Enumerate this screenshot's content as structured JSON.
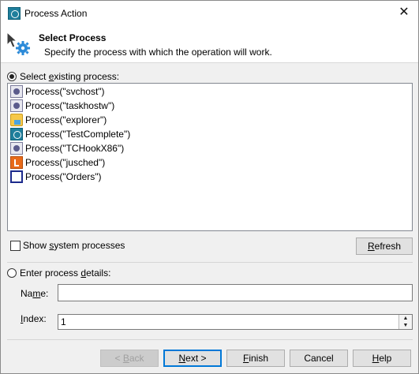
{
  "window": {
    "title": "Process Action",
    "close_glyph": "✕",
    "app_icon": "testcomplete-icon"
  },
  "header": {
    "title": "Select Process",
    "subtitle": "Specify the process with which the operation will work."
  },
  "existing": {
    "radio_label_pre": "Select ",
    "radio_label_accel": "e",
    "radio_label_post": "xisting process:",
    "selected": true,
    "processes": [
      {
        "label": "Process(\"svchost\")",
        "icon": "gear"
      },
      {
        "label": "Process(\"taskhostw\")",
        "icon": "gear"
      },
      {
        "label": "Process(\"explorer\")",
        "icon": "folder"
      },
      {
        "label": "Process(\"TestComplete\")",
        "icon": "tc"
      },
      {
        "label": "Process(\"TCHookX86\")",
        "icon": "gear"
      },
      {
        "label": "Process(\"jusched\")",
        "icon": "java"
      },
      {
        "label": "Process(\"Orders\")",
        "icon": "win"
      }
    ]
  },
  "system": {
    "label_pre": "Show ",
    "label_accel": "s",
    "label_post": "ystem processes",
    "checked": false
  },
  "refresh": {
    "label_pre": "",
    "label_accel": "R",
    "label_post": "efresh"
  },
  "details": {
    "radio_label_pre": "Enter process ",
    "radio_label_accel": "d",
    "radio_label_post": "etails:",
    "selected": false,
    "name_label_pre": "Na",
    "name_label_accel": "m",
    "name_label_post": "e:",
    "name_value": "",
    "index_label_pre": "",
    "index_label_accel": "I",
    "index_label_post": "ndex:",
    "index_value": "1"
  },
  "buttons": {
    "back": {
      "pre": "< ",
      "accel": "B",
      "post": "ack"
    },
    "next": {
      "pre": "",
      "accel": "N",
      "post": "ext >"
    },
    "finish": {
      "pre": "",
      "accel": "F",
      "post": "inish"
    },
    "cancel": {
      "pre": "Cancel",
      "accel": "",
      "post": ""
    },
    "help": {
      "pre": "",
      "accel": "H",
      "post": "elp"
    }
  }
}
